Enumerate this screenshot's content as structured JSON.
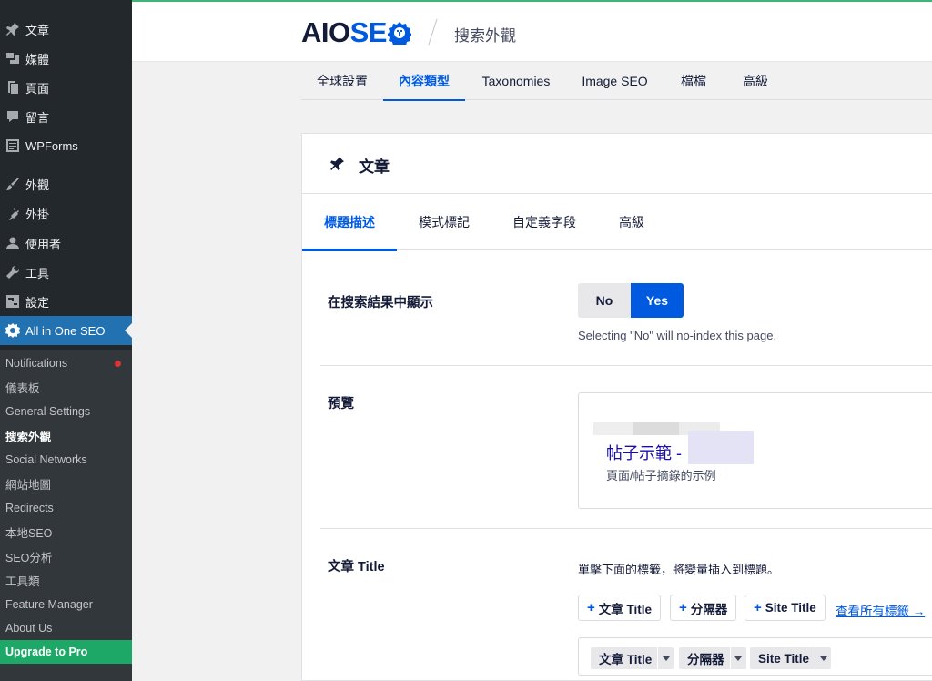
{
  "sidebar": {
    "items": [
      {
        "label": "文章",
        "icon": "pin-icon"
      },
      {
        "label": "媒體",
        "icon": "media-icon"
      },
      {
        "label": "頁面",
        "icon": "page-icon"
      },
      {
        "label": "留言",
        "icon": "comment-icon"
      },
      {
        "label": "WPForms",
        "icon": "forms-icon"
      },
      {
        "label": "外觀",
        "icon": "brush-icon"
      },
      {
        "label": "外掛",
        "icon": "plugin-icon"
      },
      {
        "label": "使用者",
        "icon": "user-icon"
      },
      {
        "label": "工具",
        "icon": "wrench-icon"
      },
      {
        "label": "設定",
        "icon": "settings-icon"
      },
      {
        "label": "All in One SEO",
        "icon": "aioseo-icon"
      }
    ],
    "submenu": [
      {
        "label": "Notifications"
      },
      {
        "label": "儀表板"
      },
      {
        "label": "General Settings"
      },
      {
        "label": "搜索外觀"
      },
      {
        "label": "Social Networks"
      },
      {
        "label": "網站地圖"
      },
      {
        "label": "Redirects"
      },
      {
        "label": "本地SEO"
      },
      {
        "label": "SEO分析"
      },
      {
        "label": "工具類"
      },
      {
        "label": "Feature Manager"
      },
      {
        "label": "About Us"
      },
      {
        "label": "Upgrade to Pro"
      }
    ]
  },
  "header": {
    "logo_aio": "AIO",
    "logo_seo": "SE",
    "title": "搜索外觀"
  },
  "main_tabs": [
    {
      "label": "全球設置"
    },
    {
      "label": "內容類型"
    },
    {
      "label": "Taxonomies"
    },
    {
      "label": "Image SEO"
    },
    {
      "label": "檔檔"
    },
    {
      "label": "高級"
    }
  ],
  "card": {
    "title": "文章",
    "sub_tabs": [
      {
        "label": "標題描述"
      },
      {
        "label": "模式標記"
      },
      {
        "label": "自定義字段"
      },
      {
        "label": "高級"
      }
    ],
    "show_in_results": {
      "label": "在搜索結果中顯示",
      "no": "No",
      "yes": "Yes",
      "help": "Selecting \"No\" will no-index this page."
    },
    "preview": {
      "label": "預覽",
      "title": "帖子示範 -",
      "description": "頁面/帖子摘錄的示例"
    },
    "post_title": {
      "label": "文章 Title",
      "help": "單擊下面的標籤，將變量插入到標題。",
      "tags": [
        "文章 Title",
        "分隔器",
        "Site Title"
      ],
      "view_all": "查看所有標籤 →",
      "chips": [
        "文章 Title",
        "分隔器",
        "Site Title"
      ]
    }
  },
  "colors": {
    "accent": "#005ae0",
    "sidebar": "#23282d",
    "submenu": "#32373c",
    "active_menu": "#2271b1",
    "upgrade": "#1da867"
  }
}
